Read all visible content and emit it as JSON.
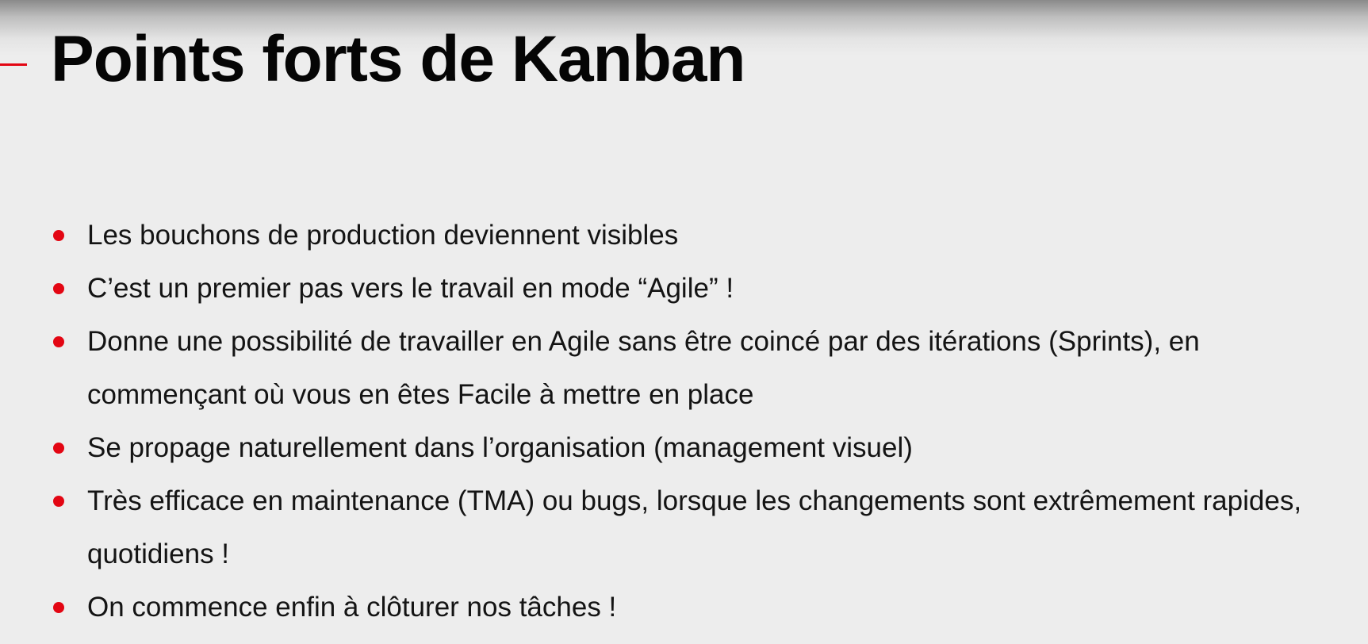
{
  "slide": {
    "title": "Points forts de Kanban",
    "accent_color": "#e30613",
    "bullets": [
      "Les bouchons de production deviennent visibles",
      "C’est un premier pas vers le travail en mode “Agile” !",
      "Donne une possibilité de travailler en Agile sans être coincé par des itérations (Sprints), en commençant où vous en êtes Facile à mettre en place",
      "Se propage naturellement dans l’organisation (management visuel)",
      "Très efficace en maintenance (TMA) ou bugs, lorsque les changements sont extrêmement rapides, quotidiens !",
      "On commence enfin à clôturer nos tâches !"
    ]
  }
}
